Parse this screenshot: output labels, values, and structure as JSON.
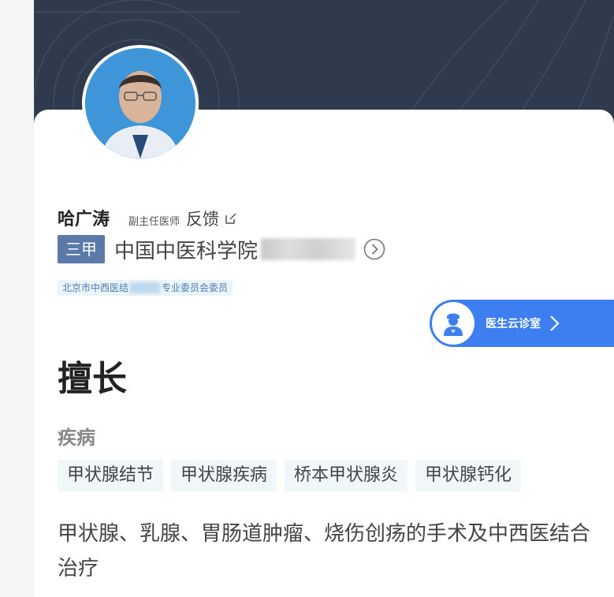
{
  "doctor": {
    "name": "哈广涛",
    "title": "副主任医师",
    "feedback_label": "反馈",
    "photo_icon": "doctor-portrait"
  },
  "hospital": {
    "grade": "三甲",
    "name": "中国中医科学院"
  },
  "committee": {
    "prefix": "北京市中西医结",
    "suffix": "专业委员会委员"
  },
  "cloud_clinic": {
    "label": "医生云诊室",
    "icon": "doctor-icon"
  },
  "expertise": {
    "title": "擅长",
    "disease_label": "疾病",
    "tags": [
      "甲状腺结节",
      "甲状腺疾病",
      "桥本甲状腺炎",
      "甲状腺钙化"
    ],
    "description": "甲状腺、乳腺、胃肠道肿瘤、烧伤创疡的手术及中西医结合治疗"
  },
  "colors": {
    "header_bg": "#2f3a4c",
    "accent_blue": "#3d7ff1",
    "grade_badge": "#5b7aaa"
  }
}
